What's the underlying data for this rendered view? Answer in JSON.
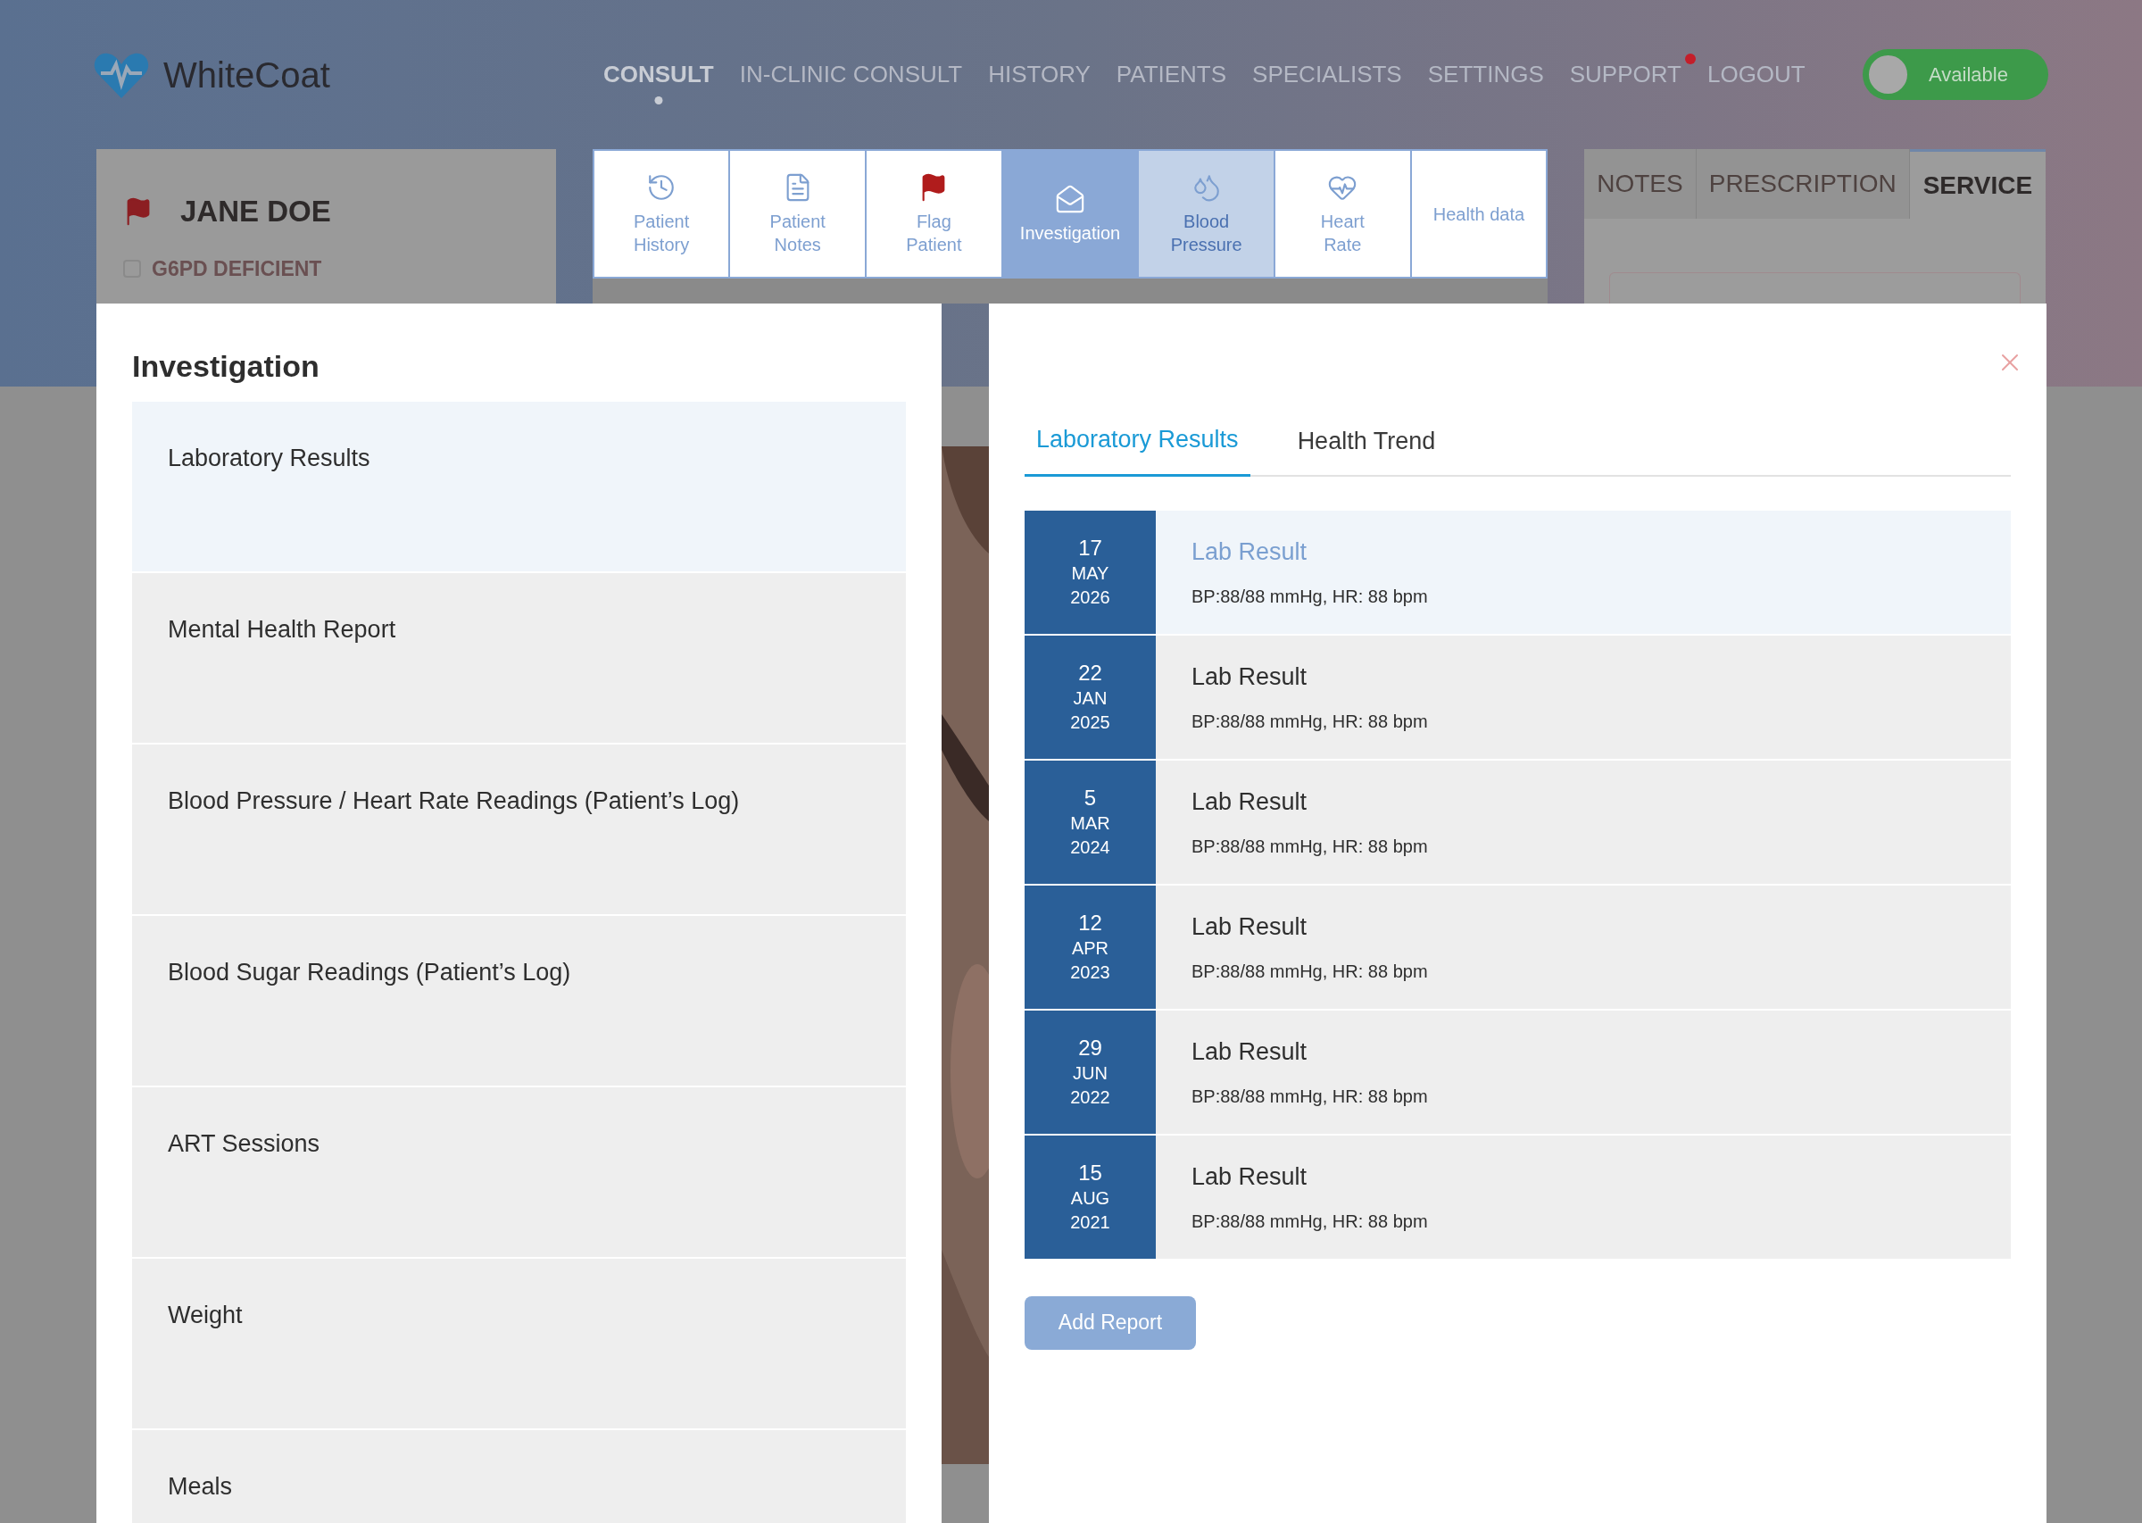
{
  "header": {
    "logo": "WhiteCoat",
    "nav": [
      {
        "label": "CONSULT",
        "selected": true
      },
      {
        "label": "IN-CLINIC CONSULT",
        "selected": false
      },
      {
        "label": "HISTORY",
        "selected": false
      },
      {
        "label": "PATIENTS",
        "selected": false
      },
      {
        "label": "SPECIALISTS",
        "selected": false
      },
      {
        "label": "SETTINGS",
        "selected": false
      },
      {
        "label": "SUPPORT",
        "selected": false,
        "notification": true
      },
      {
        "label": "LOGOUT",
        "selected": false
      }
    ],
    "availability": {
      "label": "Available",
      "on": true
    }
  },
  "patient": {
    "name": "JANE DOE",
    "flagged": true,
    "conditions": [
      {
        "label": "G6PD DEFICIENT",
        "checked": false
      }
    ]
  },
  "toolbar": [
    {
      "kind": "history",
      "lines": [
        "Patient",
        "History"
      ],
      "selected": false,
      "disabled": false
    },
    {
      "kind": "notes",
      "lines": [
        "Patient",
        "Notes"
      ],
      "selected": false,
      "disabled": false
    },
    {
      "kind": "flag",
      "lines": [
        "Flag",
        "Patient"
      ],
      "selected": false,
      "disabled": false
    },
    {
      "kind": "investigation",
      "lines": [
        "Investigation"
      ],
      "selected": true,
      "disabled": false
    },
    {
      "kind": "blood-pressure",
      "lines": [
        "Blood",
        "Pressure"
      ],
      "selected": false,
      "disabled": true
    },
    {
      "kind": "heart-rate",
      "lines": [
        "Heart",
        "Rate"
      ],
      "selected": false,
      "disabled": false
    },
    {
      "kind": "text",
      "lines": [
        "Health data"
      ],
      "selected": false,
      "disabled": false
    }
  ],
  "side_tabs": [
    {
      "label": "NOTES",
      "selected": false
    },
    {
      "label": "PRESCRIPTION",
      "selected": false
    },
    {
      "label": "SERVICE",
      "selected": true
    }
  ],
  "investigation": {
    "title": "Investigation",
    "items": [
      {
        "label": "Laboratory Results",
        "selected": true
      },
      {
        "label": "Mental Health Report",
        "selected": false
      },
      {
        "label": "Blood Pressure / Heart Rate Readings (Patient’s Log)",
        "selected": false
      },
      {
        "label": "Blood Sugar Readings (Patient’s Log)",
        "selected": false
      },
      {
        "label": "ART Sessions",
        "selected": false
      },
      {
        "label": "Weight",
        "selected": false
      },
      {
        "label": "Meals",
        "selected": false
      }
    ]
  },
  "results": {
    "tabs": [
      {
        "label": "Laboratory Results",
        "selected": true
      },
      {
        "label": "Health Trend",
        "selected": false
      }
    ],
    "rows": [
      {
        "day": "17",
        "month": "MAY",
        "year": "2026",
        "title": "Lab Result",
        "summary": "BP:88/88 mmHg, HR: 88 bpm",
        "selected": true
      },
      {
        "day": "22",
        "month": "JAN",
        "year": "2025",
        "title": "Lab Result",
        "summary": "BP:88/88 mmHg, HR: 88 bpm",
        "selected": false
      },
      {
        "day": "5",
        "month": "MAR",
        "year": "2024",
        "title": "Lab Result",
        "summary": "BP:88/88 mmHg, HR: 88 bpm",
        "selected": false
      },
      {
        "day": "12",
        "month": "APR",
        "year": "2023",
        "title": "Lab Result",
        "summary": "BP:88/88 mmHg, HR: 88 bpm",
        "selected": false
      },
      {
        "day": "29",
        "month": "JUN",
        "year": "2022",
        "title": "Lab Result",
        "summary": "BP:88/88 mmHg, HR: 88 bpm",
        "selected": false
      },
      {
        "day": "15",
        "month": "AUG",
        "year": "2021",
        "title": "Lab Result",
        "summary": "BP:88/88 mmHg, HR: 88 bpm",
        "selected": false
      }
    ],
    "add_button": "Add Report"
  }
}
